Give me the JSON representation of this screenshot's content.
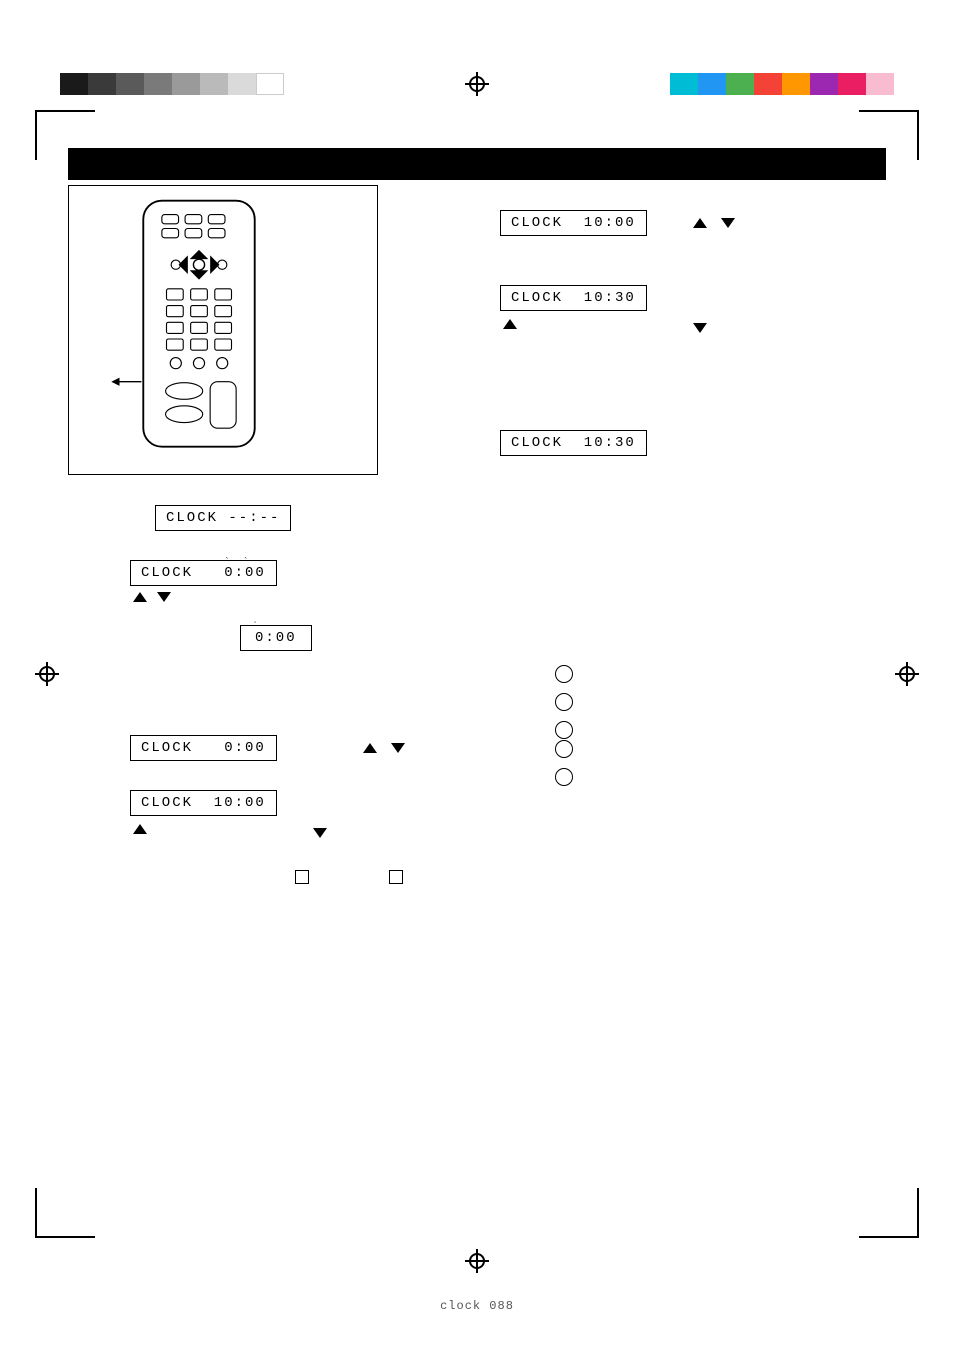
{
  "page": {
    "title": "Clock 088",
    "background": "#ffffff"
  },
  "header": {
    "bar_color": "#000000"
  },
  "color_bars_left": [
    {
      "color": "#1a1a1a"
    },
    {
      "color": "#3a3a3a"
    },
    {
      "color": "#5a5a5a"
    },
    {
      "color": "#7a7a7a"
    },
    {
      "color": "#9a9a9a"
    },
    {
      "color": "#bababa"
    },
    {
      "color": "#dadada"
    },
    {
      "color": "#ffffff"
    }
  ],
  "color_bars_right": [
    {
      "color": "#00bcd4"
    },
    {
      "color": "#2196F3"
    },
    {
      "color": "#4CAF50"
    },
    {
      "color": "#F44336"
    },
    {
      "color": "#FF9800"
    },
    {
      "color": "#9C27B0"
    },
    {
      "color": "#E91E63"
    },
    {
      "color": "#F8BBD0"
    }
  ],
  "displays": {
    "clock_dashes": "CLOCK  --:--",
    "clock_000_1": "CLOCK   0:00",
    "clock_000_small": "0:00",
    "clock_000_2": "CLOCK   0:00",
    "clock_1000": "CLOCK  10:00",
    "clock_1030": "CLOCK  10:30",
    "clock_1030_set": "CLOCK  10:30",
    "clock_1000_2": "CLOCK  10:00"
  },
  "labels": {
    "page_label": "clock 088"
  },
  "arrows": {
    "up": "△",
    "down": "▽"
  }
}
